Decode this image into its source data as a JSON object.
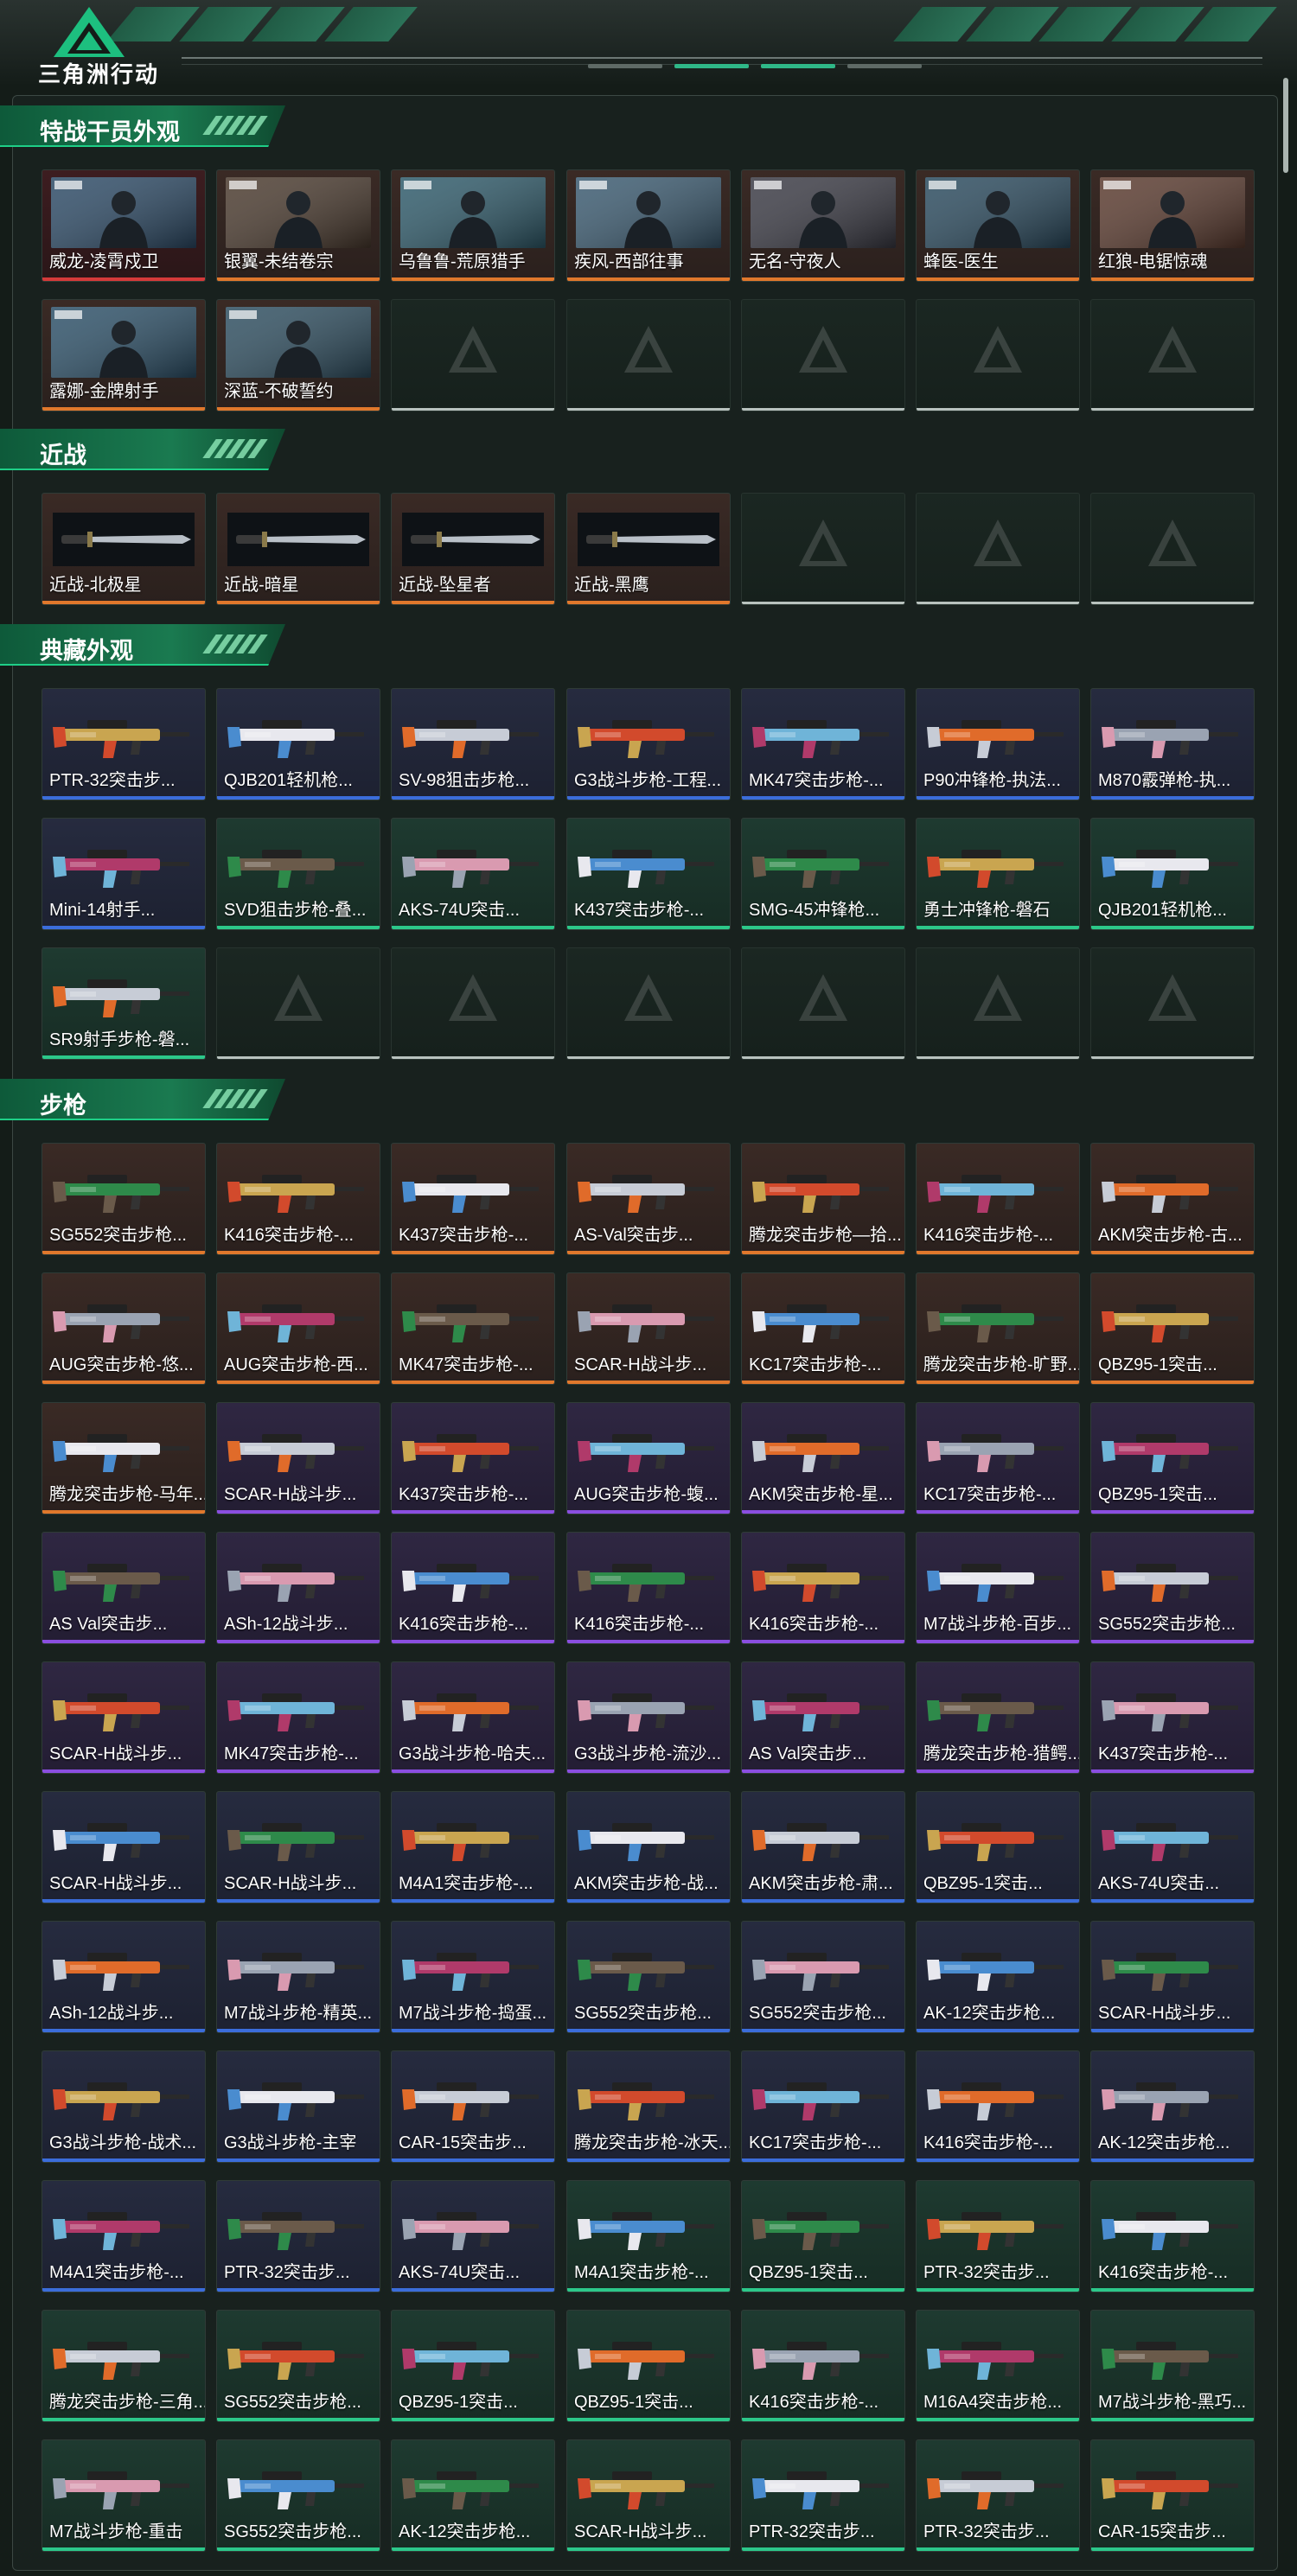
{
  "header": {
    "brand": "三角洲行动"
  },
  "sections": [
    {
      "title": "特战干员外观",
      "items": [
        {
          "label": "威龙-凌霄戍卫",
          "rarity": "red"
        },
        {
          "label": "银翼-未结卷宗",
          "rarity": "orange"
        },
        {
          "label": "乌鲁鲁-荒原猎手",
          "rarity": "orange"
        },
        {
          "label": "疾风-西部往事",
          "rarity": "orange"
        },
        {
          "label": "无名-守夜人",
          "rarity": "orange"
        },
        {
          "label": "蜂医-医生",
          "rarity": "orange"
        },
        {
          "label": "红狼-电锯惊魂",
          "rarity": "orange"
        },
        {
          "label": "露娜-金牌射手",
          "rarity": "orange"
        },
        {
          "label": "深蓝-不破誓约",
          "rarity": "orange"
        },
        {
          "label": "",
          "rarity": "empty"
        },
        {
          "label": "",
          "rarity": "empty"
        },
        {
          "label": "",
          "rarity": "empty"
        },
        {
          "label": "",
          "rarity": "empty"
        },
        {
          "label": "",
          "rarity": "empty"
        }
      ]
    },
    {
      "title": "近战",
      "items": [
        {
          "label": "近战-北极星",
          "rarity": "orange"
        },
        {
          "label": "近战-暗星",
          "rarity": "orange"
        },
        {
          "label": "近战-坠星者",
          "rarity": "orange"
        },
        {
          "label": "近战-黑鹰",
          "rarity": "orange"
        },
        {
          "label": "",
          "rarity": "empty"
        },
        {
          "label": "",
          "rarity": "empty"
        },
        {
          "label": "",
          "rarity": "empty"
        }
      ]
    },
    {
      "title": "典藏外观",
      "items": [
        {
          "label": "PTR-32突击步...",
          "rarity": "blue"
        },
        {
          "label": "QJB201轻机枪...",
          "rarity": "blue"
        },
        {
          "label": "SV-98狙击步枪...",
          "rarity": "blue"
        },
        {
          "label": "G3战斗步枪-工程...",
          "rarity": "blue"
        },
        {
          "label": "MK47突击步枪-...",
          "rarity": "blue"
        },
        {
          "label": "P90冲锋枪-执法...",
          "rarity": "blue"
        },
        {
          "label": "M870霰弹枪-执...",
          "rarity": "blue"
        },
        {
          "label": "Mini-14射手...",
          "rarity": "blue"
        },
        {
          "label": "SVD狙击步枪-叠...",
          "rarity": "green"
        },
        {
          "label": "AKS-74U突击...",
          "rarity": "green"
        },
        {
          "label": "K437突击步枪-...",
          "rarity": "green"
        },
        {
          "label": "SMG-45冲锋枪...",
          "rarity": "green"
        },
        {
          "label": "勇士冲锋枪-磐石",
          "rarity": "green"
        },
        {
          "label": "QJB201轻机枪...",
          "rarity": "green"
        },
        {
          "label": "SR9射手步枪-磐...",
          "rarity": "green"
        },
        {
          "label": "",
          "rarity": "empty"
        },
        {
          "label": "",
          "rarity": "empty"
        },
        {
          "label": "",
          "rarity": "empty"
        },
        {
          "label": "",
          "rarity": "empty"
        },
        {
          "label": "",
          "rarity": "empty"
        },
        {
          "label": "",
          "rarity": "empty"
        }
      ]
    },
    {
      "title": "步枪",
      "items": [
        {
          "label": "SG552突击步枪...",
          "rarity": "orange"
        },
        {
          "label": "K416突击步枪-...",
          "rarity": "orange"
        },
        {
          "label": "K437突击步枪-...",
          "rarity": "orange"
        },
        {
          "label": "AS-Val突击步...",
          "rarity": "orange"
        },
        {
          "label": "腾龙突击步枪—拾...",
          "rarity": "orange"
        },
        {
          "label": "K416突击步枪-...",
          "rarity": "orange"
        },
        {
          "label": "AKM突击步枪-古...",
          "rarity": "orange"
        },
        {
          "label": "AUG突击步枪-悠...",
          "rarity": "orange"
        },
        {
          "label": "AUG突击步枪-西...",
          "rarity": "orange"
        },
        {
          "label": "MK47突击步枪-...",
          "rarity": "orange"
        },
        {
          "label": "SCAR-H战斗步...",
          "rarity": "orange"
        },
        {
          "label": "KC17突击步枪-...",
          "rarity": "orange"
        },
        {
          "label": "腾龙突击步枪-旷野...",
          "rarity": "orange"
        },
        {
          "label": "QBZ95-1突击...",
          "rarity": "orange"
        },
        {
          "label": "腾龙突击步枪-马年...",
          "rarity": "orange"
        },
        {
          "label": "SCAR-H战斗步...",
          "rarity": "purple"
        },
        {
          "label": "K437突击步枪-...",
          "rarity": "purple"
        },
        {
          "label": "AUG突击步枪-蝮...",
          "rarity": "purple"
        },
        {
          "label": "AKM突击步枪-星...",
          "rarity": "purple"
        },
        {
          "label": "KC17突击步枪-...",
          "rarity": "purple"
        },
        {
          "label": "QBZ95-1突击...",
          "rarity": "purple"
        },
        {
          "label": "AS Val突击步...",
          "rarity": "purple"
        },
        {
          "label": "ASh-12战斗步...",
          "rarity": "purple"
        },
        {
          "label": "K416突击步枪-...",
          "rarity": "purple"
        },
        {
          "label": "K416突击步枪-...",
          "rarity": "purple"
        },
        {
          "label": "K416突击步枪-...",
          "rarity": "purple"
        },
        {
          "label": "M7战斗步枪-百步...",
          "rarity": "purple"
        },
        {
          "label": "SG552突击步枪...",
          "rarity": "purple"
        },
        {
          "label": "SCAR-H战斗步...",
          "rarity": "purple"
        },
        {
          "label": "MK47突击步枪-...",
          "rarity": "purple"
        },
        {
          "label": "G3战斗步枪-哈夫...",
          "rarity": "purple"
        },
        {
          "label": "G3战斗步枪-流沙...",
          "rarity": "purple"
        },
        {
          "label": "AS Val突击步...",
          "rarity": "purple"
        },
        {
          "label": "腾龙突击步枪-猎鳄...",
          "rarity": "purple"
        },
        {
          "label": "K437突击步枪-...",
          "rarity": "purple"
        },
        {
          "label": "SCAR-H战斗步...",
          "rarity": "blue"
        },
        {
          "label": "SCAR-H战斗步...",
          "rarity": "blue"
        },
        {
          "label": "M4A1突击步枪-...",
          "rarity": "blue"
        },
        {
          "label": "AKM突击步枪-战...",
          "rarity": "blue"
        },
        {
          "label": "AKM突击步枪-肃...",
          "rarity": "blue"
        },
        {
          "label": "QBZ95-1突击...",
          "rarity": "blue"
        },
        {
          "label": "AKS-74U突击...",
          "rarity": "blue"
        },
        {
          "label": "ASh-12战斗步...",
          "rarity": "blue"
        },
        {
          "label": "M7战斗步枪-精英...",
          "rarity": "blue"
        },
        {
          "label": "M7战斗步枪-捣蛋...",
          "rarity": "blue"
        },
        {
          "label": "SG552突击步枪...",
          "rarity": "blue"
        },
        {
          "label": "SG552突击步枪...",
          "rarity": "blue"
        },
        {
          "label": "AK-12突击步枪...",
          "rarity": "blue"
        },
        {
          "label": "SCAR-H战斗步...",
          "rarity": "blue"
        },
        {
          "label": "G3战斗步枪-战术...",
          "rarity": "blue"
        },
        {
          "label": "G3战斗步枪-主宰",
          "rarity": "blue"
        },
        {
          "label": "CAR-15突击步...",
          "rarity": "blue"
        },
        {
          "label": "腾龙突击步枪-冰天...",
          "rarity": "blue"
        },
        {
          "label": "KC17突击步枪-...",
          "rarity": "blue"
        },
        {
          "label": "K416突击步枪-...",
          "rarity": "blue"
        },
        {
          "label": "AK-12突击步枪...",
          "rarity": "blue"
        },
        {
          "label": "M4A1突击步枪-...",
          "rarity": "blue"
        },
        {
          "label": "PTR-32突击步...",
          "rarity": "blue"
        },
        {
          "label": "AKS-74U突击...",
          "rarity": "blue"
        },
        {
          "label": "M4A1突击步枪-...",
          "rarity": "green"
        },
        {
          "label": "QBZ95-1突击...",
          "rarity": "green"
        },
        {
          "label": "PTR-32突击步...",
          "rarity": "green"
        },
        {
          "label": "K416突击步枪-...",
          "rarity": "green"
        },
        {
          "label": "腾龙突击步枪-三角...",
          "rarity": "green"
        },
        {
          "label": "SG552突击步枪...",
          "rarity": "green"
        },
        {
          "label": "QBZ95-1突击...",
          "rarity": "green"
        },
        {
          "label": "QBZ95-1突击...",
          "rarity": "green"
        },
        {
          "label": "K416突击步枪-...",
          "rarity": "green"
        },
        {
          "label": "M16A4突击步枪...",
          "rarity": "green"
        },
        {
          "label": "M7战斗步枪-黑巧...",
          "rarity": "green"
        },
        {
          "label": "M7战斗步枪-重击",
          "rarity": "green"
        },
        {
          "label": "SG552突击步枪...",
          "rarity": "green"
        },
        {
          "label": "AK-12突击步枪...",
          "rarity": "green"
        },
        {
          "label": "SCAR-H战斗步...",
          "rarity": "green"
        },
        {
          "label": "PTR-32突击步...",
          "rarity": "green"
        },
        {
          "label": "PTR-32突击步...",
          "rarity": "green"
        },
        {
          "label": "CAR-15突击步...",
          "rarity": "green"
        }
      ]
    }
  ]
}
